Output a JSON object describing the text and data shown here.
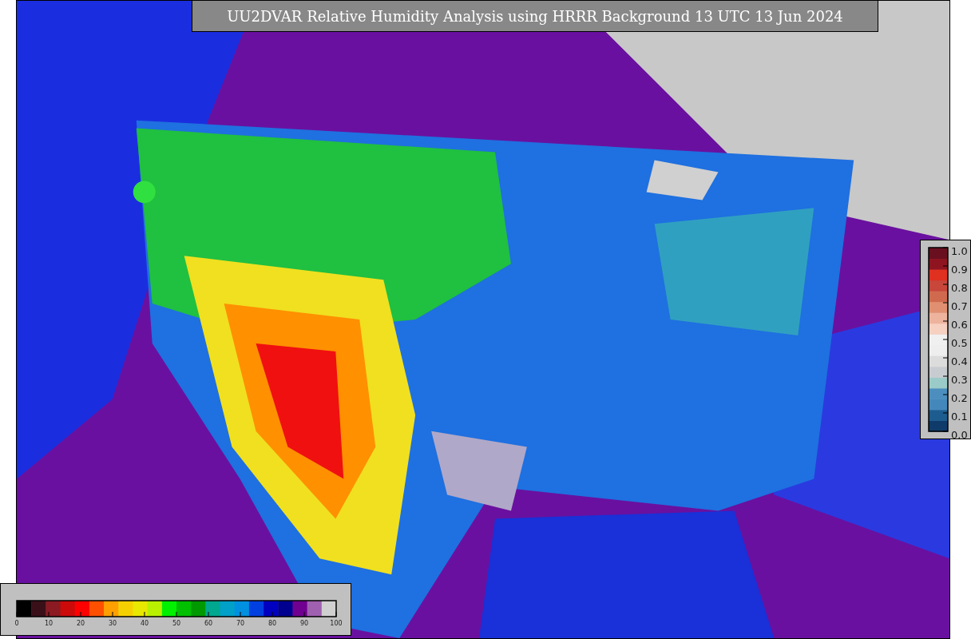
{
  "title": "UU2DVAR Relative Humidity Analysis using HRRR Background 13 UTC 13 Jun 2024",
  "humidity_colorbar": {
    "ticks": [
      "0",
      "10",
      "20",
      "30",
      "40",
      "50",
      "60",
      "70",
      "80",
      "90",
      "100"
    ]
  },
  "side_colorbar": {
    "ticks": [
      "1.0",
      "0.9",
      "0.8",
      "0.7",
      "0.6",
      "0.5",
      "0.4",
      "0.3",
      "0.2",
      "0.1",
      "0.0"
    ]
  }
}
